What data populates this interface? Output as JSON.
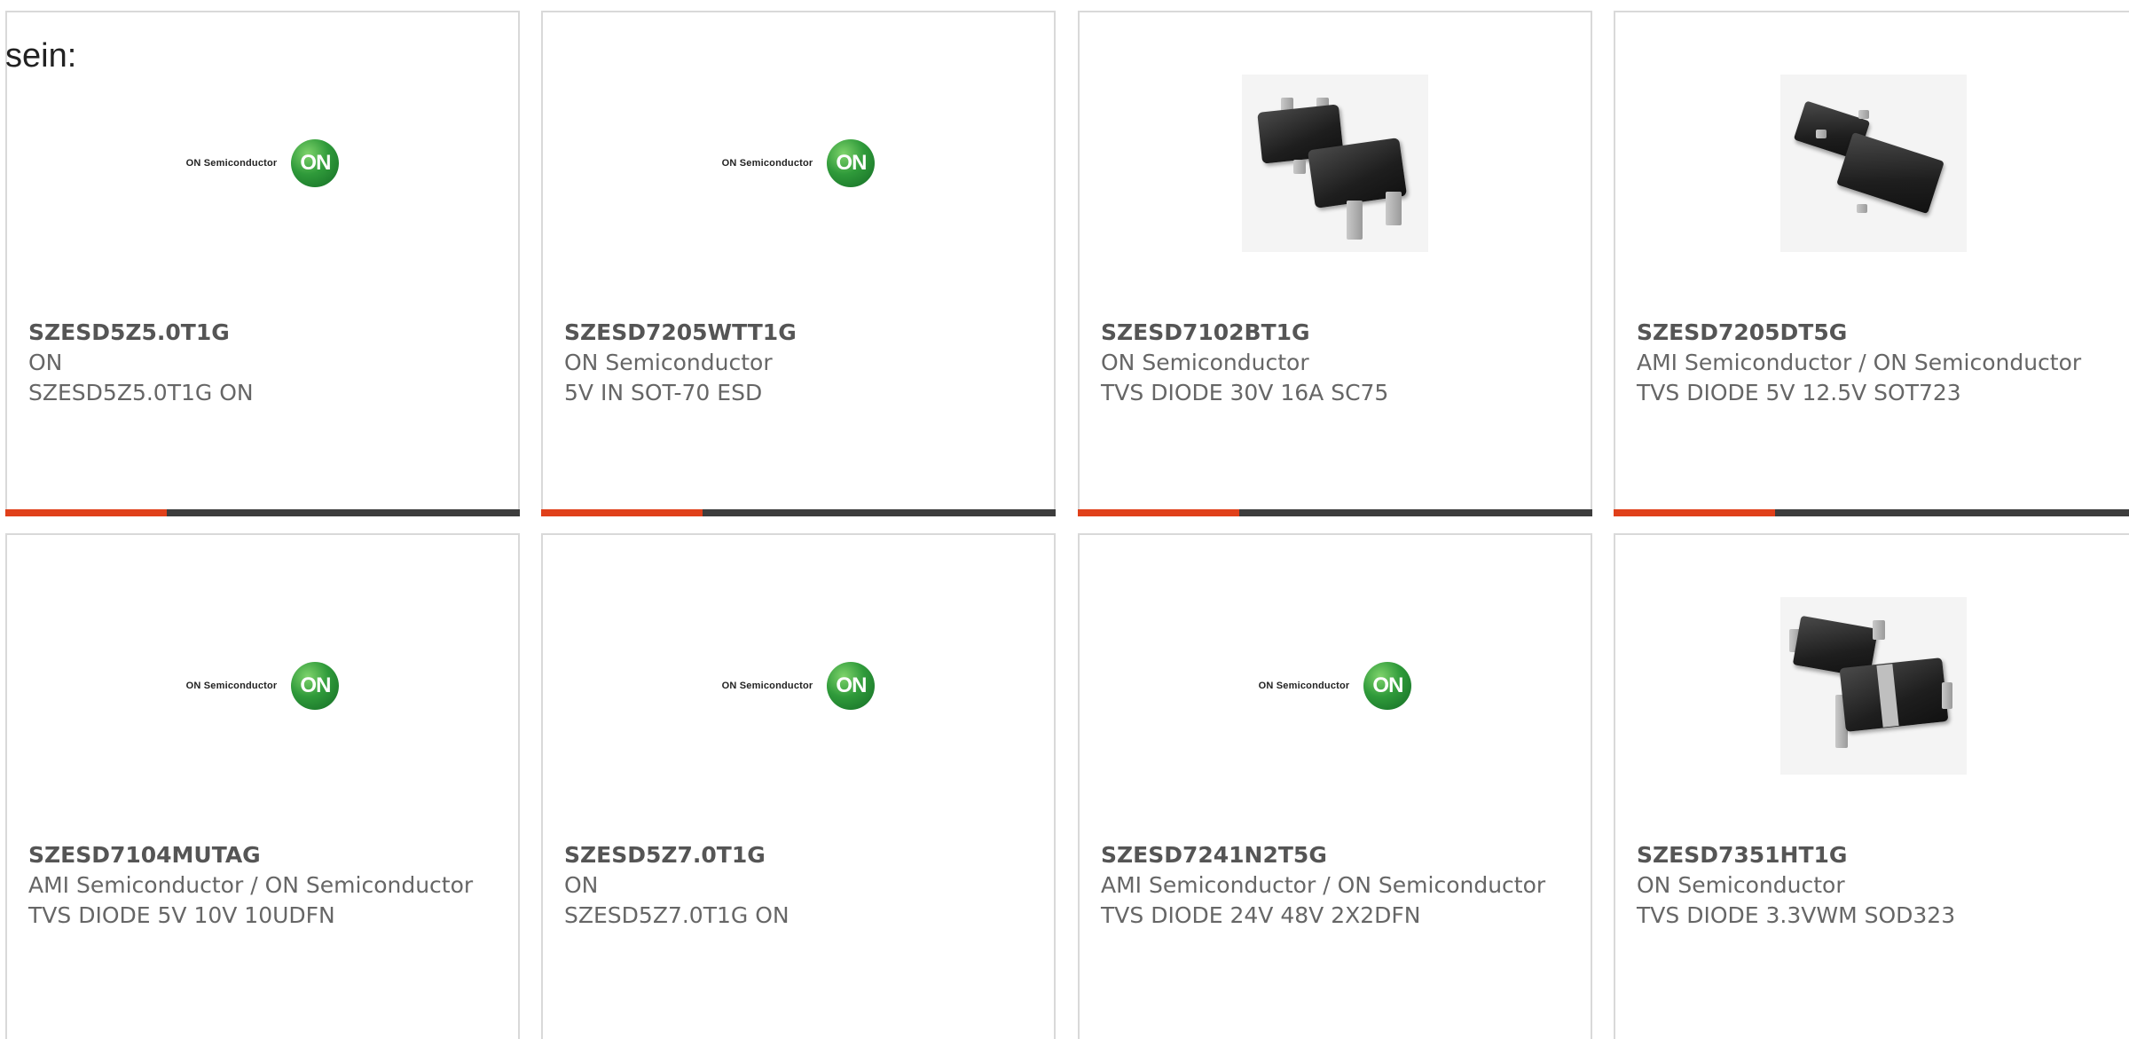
{
  "intro_text": "sein:",
  "products": [
    {
      "part": "SZESD5Z5.0T1G",
      "maker": "ON",
      "desc": "SZESD5Z5.0T1G ON",
      "image": "on-semiconductor-logo"
    },
    {
      "part": "SZESD7205WTT1G",
      "maker": "ON Semiconductor",
      "desc": "5V IN SOT-70 ESD",
      "image": "on-semiconductor-logo"
    },
    {
      "part": "SZESD7102BT1G",
      "maker": "ON Semiconductor",
      "desc": "TVS DIODE 30V 16A SC75",
      "image": "sc75-package-photo"
    },
    {
      "part": "SZESD7205DT5G",
      "maker": "AMI Semiconductor / ON Semiconductor",
      "desc": "TVS DIODE 5V 12.5V SOT723",
      "image": "sot723-package-photo"
    },
    {
      "part": "SZESD7104MUTAG",
      "maker": "AMI Semiconductor / ON Semiconductor",
      "desc": "TVS DIODE 5V 10V 10UDFN",
      "image": "on-semiconductor-logo"
    },
    {
      "part": "SZESD5Z7.0T1G",
      "maker": "ON",
      "desc": "SZESD5Z7.0T1G ON",
      "image": "on-semiconductor-logo"
    },
    {
      "part": "SZESD7241N2T5G",
      "maker": "AMI Semiconductor / ON Semiconductor",
      "desc": "TVS DIODE 24V 48V 2X2DFN",
      "image": "on-semiconductor-logo"
    },
    {
      "part": "SZESD7351HT1G",
      "maker": "ON Semiconductor",
      "desc": "TVS DIODE 3.3VWM SOD323",
      "image": "sod323-package-photo"
    }
  ],
  "logo": {
    "wordmark": "ON Semiconductor",
    "badge": "ON"
  },
  "colors": {
    "accent": "#e0401a",
    "bar": "#3d3d3d",
    "border": "#d9d9d9",
    "on_green": "#2f9a3a"
  }
}
